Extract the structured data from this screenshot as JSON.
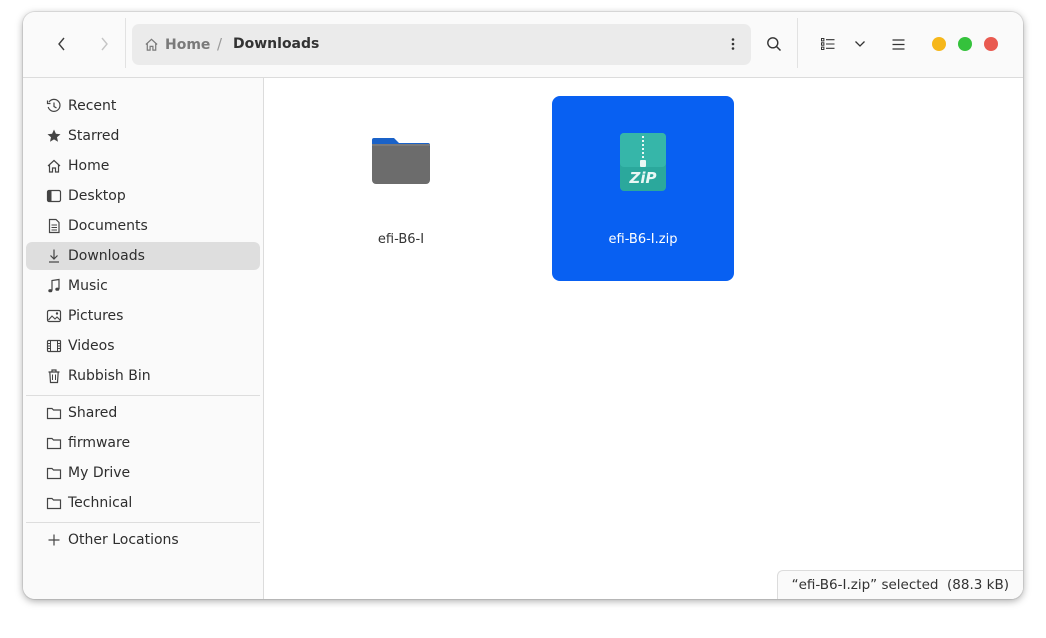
{
  "header": {
    "back_icon": "chevron-left-icon",
    "forward_icon": "chevron-right-icon",
    "breadcrumb": {
      "home_label": "Home",
      "separator": "/",
      "current_label": "Downloads"
    }
  },
  "sidebar": {
    "places": [
      {
        "label": "Recent",
        "icon": "clock-icon"
      },
      {
        "label": "Starred",
        "icon": "star-icon"
      },
      {
        "label": "Home",
        "icon": "home-icon"
      },
      {
        "label": "Desktop",
        "icon": "desktop-icon"
      },
      {
        "label": "Documents",
        "icon": "document-icon"
      },
      {
        "label": "Downloads",
        "icon": "download-icon",
        "active": true
      },
      {
        "label": "Music",
        "icon": "music-icon"
      },
      {
        "label": "Pictures",
        "icon": "picture-icon"
      },
      {
        "label": "Videos",
        "icon": "video-icon"
      },
      {
        "label": "Rubbish Bin",
        "icon": "trash-icon"
      }
    ],
    "bookmarks": [
      {
        "label": "Shared",
        "icon": "folder-icon"
      },
      {
        "label": "firmware",
        "icon": "folder-icon"
      },
      {
        "label": "My Drive",
        "icon": "folder-icon"
      },
      {
        "label": "Technical",
        "icon": "folder-icon"
      }
    ],
    "other": {
      "label": "Other Locations",
      "icon": "plus-icon"
    }
  },
  "files": [
    {
      "name": "efi-B6-I",
      "type": "folder",
      "selected": false
    },
    {
      "name": "efi-B6-I.zip",
      "type": "zip",
      "selected": true
    }
  ],
  "status": {
    "text": "“efi-B6-I.zip” selected  (88.3 kB)"
  },
  "colors": {
    "selection": "#0860f2",
    "minimize": "#f6b71a",
    "maximize": "#35c23c",
    "close": "#e95a50"
  }
}
